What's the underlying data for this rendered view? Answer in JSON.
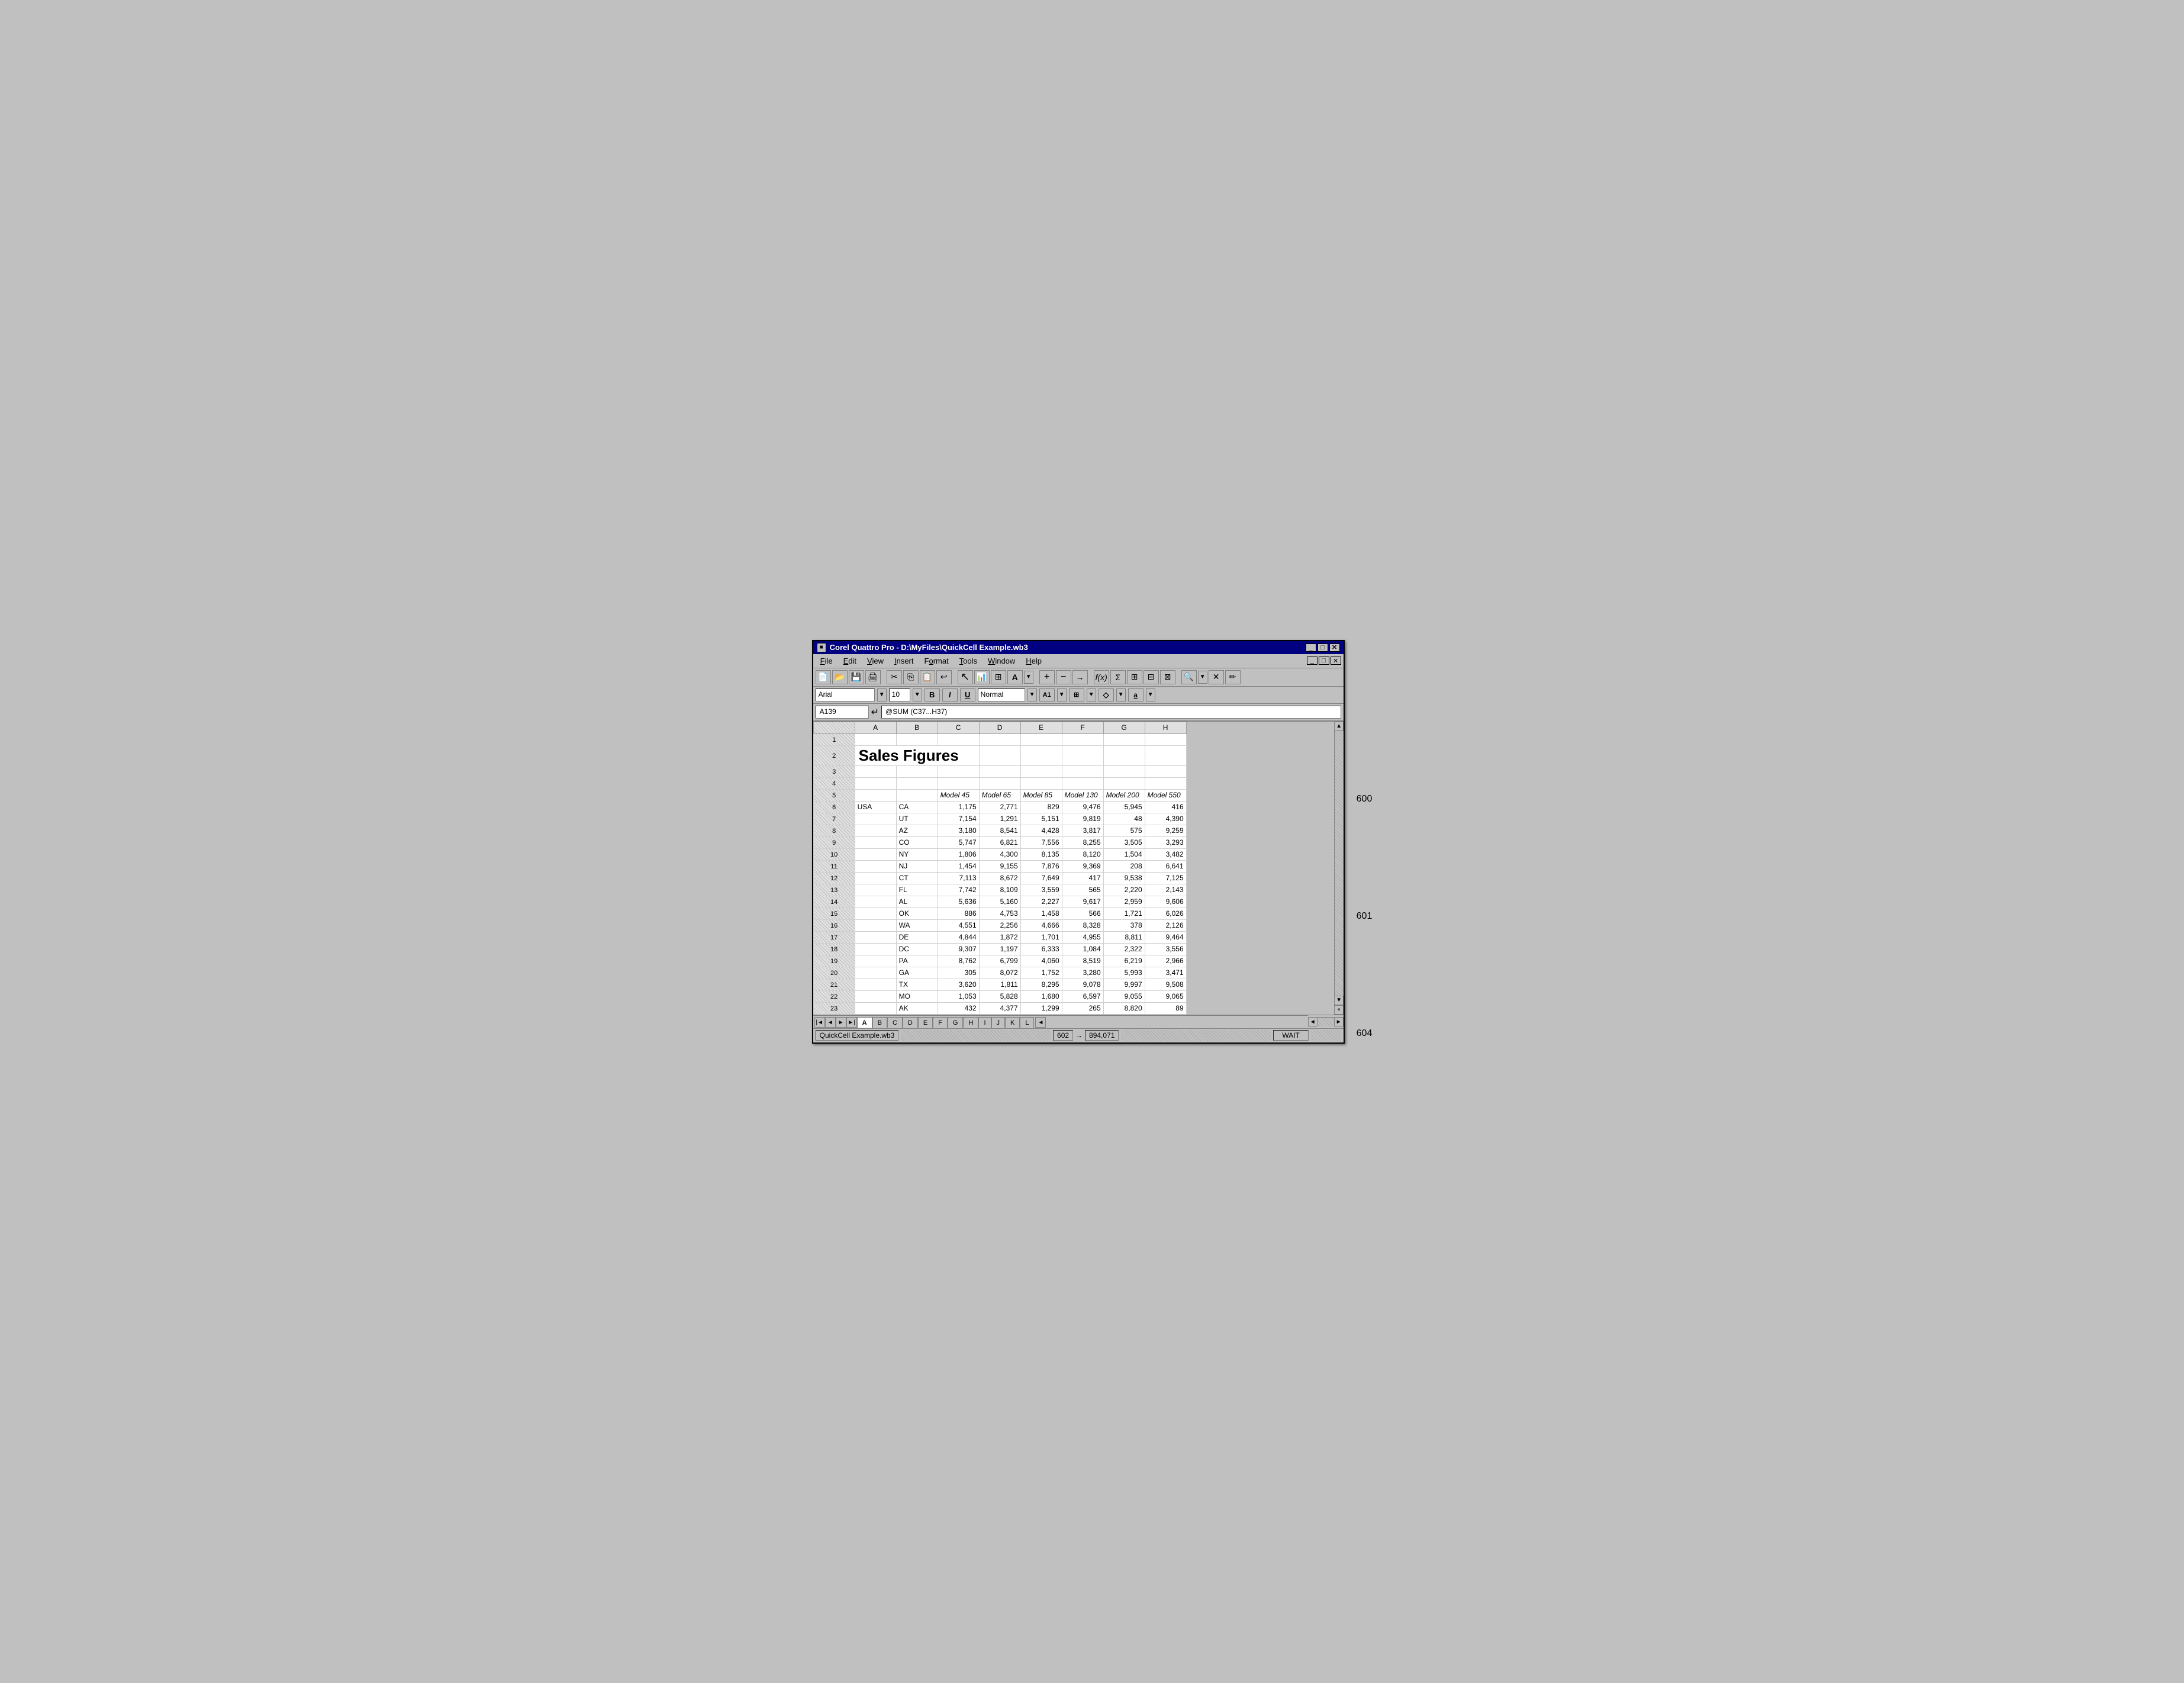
{
  "window": {
    "title": "Corel Quattro Pro - D:\\MyFiles\\QuickCell Example.wb3",
    "icon": "■"
  },
  "menu": {
    "items": [
      "File",
      "Edit",
      "View",
      "Insert",
      "Format",
      "Tools",
      "Window",
      "Help"
    ]
  },
  "formula_bar": {
    "cell_ref": "A139",
    "formula": "@SUM (C37...H37)"
  },
  "format_bar": {
    "font": "Arial",
    "size": "10",
    "style": "Normal",
    "bold": "B",
    "italic": "I",
    "underline": "U"
  },
  "columns": [
    "A",
    "B",
    "C",
    "D",
    "E",
    "F",
    "G",
    "H"
  ],
  "rows": [
    {
      "num": "1",
      "cells": [
        "",
        "",
        "",
        "",
        "",
        "",
        "",
        ""
      ]
    },
    {
      "num": "2",
      "cells": [
        "Sales Figures",
        "",
        "",
        "",
        "",
        "",
        "",
        ""
      ]
    },
    {
      "num": "3",
      "cells": [
        "",
        "",
        "",
        "",
        "",
        "",
        "",
        ""
      ]
    },
    {
      "num": "4",
      "cells": [
        "",
        "",
        "",
        "",
        "",
        "",
        "",
        ""
      ]
    },
    {
      "num": "5",
      "cells": [
        "",
        "",
        "Model 45",
        "Model 65",
        "Model 85",
        "Model 130",
        "Model 200",
        "Model 550"
      ]
    },
    {
      "num": "6",
      "cells": [
        "USA",
        "CA",
        "1,175",
        "2,771",
        "829",
        "9,476",
        "5,945",
        "416"
      ]
    },
    {
      "num": "7",
      "cells": [
        "",
        "UT",
        "7,154",
        "1,291",
        "5,151",
        "9,819",
        "48",
        "4,390"
      ]
    },
    {
      "num": "8",
      "cells": [
        "",
        "AZ",
        "3,180",
        "8,541",
        "4,428",
        "3,817",
        "575",
        "9,259"
      ]
    },
    {
      "num": "9",
      "cells": [
        "",
        "CO",
        "5,747",
        "6,821",
        "7,556",
        "8,255",
        "3,505",
        "3,293"
      ]
    },
    {
      "num": "10",
      "cells": [
        "",
        "NY",
        "1,806",
        "4,300",
        "8,135",
        "8,120",
        "1,504",
        "3,482"
      ]
    },
    {
      "num": "11",
      "cells": [
        "",
        "NJ",
        "1,454",
        "9,155",
        "7,876",
        "9,369",
        "208",
        "6,641"
      ]
    },
    {
      "num": "12",
      "cells": [
        "",
        "CT",
        "7,113",
        "8,672",
        "7,649",
        "417",
        "9,538",
        "7,125"
      ]
    },
    {
      "num": "13",
      "cells": [
        "",
        "FL",
        "7,742",
        "8,109",
        "3,559",
        "565",
        "2,220",
        "2,143"
      ]
    },
    {
      "num": "14",
      "cells": [
        "",
        "AL",
        "5,636",
        "5,160",
        "2,227",
        "9,617",
        "2,959",
        "9,606"
      ]
    },
    {
      "num": "15",
      "cells": [
        "",
        "OK",
        "886",
        "4,753",
        "1,458",
        "566",
        "1,721",
        "6,026"
      ]
    },
    {
      "num": "16",
      "cells": [
        "",
        "WA",
        "4,551",
        "2,256",
        "4,666",
        "8,328",
        "378",
        "2,126"
      ]
    },
    {
      "num": "17",
      "cells": [
        "",
        "DE",
        "4,844",
        "1,872",
        "1,701",
        "4,955",
        "8,811",
        "9,464"
      ]
    },
    {
      "num": "18",
      "cells": [
        "",
        "DC",
        "9,307",
        "1,197",
        "6,333",
        "1,084",
        "2,322",
        "3,556"
      ]
    },
    {
      "num": "19",
      "cells": [
        "",
        "PA",
        "8,762",
        "6,799",
        "4,060",
        "8,519",
        "6,219",
        "2,966"
      ]
    },
    {
      "num": "20",
      "cells": [
        "",
        "GA",
        "305",
        "8,072",
        "1,752",
        "3,280",
        "5,993",
        "3,471"
      ]
    },
    {
      "num": "21",
      "cells": [
        "",
        "TX",
        "3,620",
        "1,811",
        "8,295",
        "9,078",
        "9,997",
        "9,508"
      ]
    },
    {
      "num": "22",
      "cells": [
        "",
        "MO",
        "1,053",
        "5,828",
        "1,680",
        "6,597",
        "9,055",
        "9,065"
      ]
    },
    {
      "num": "23",
      "cells": [
        "",
        "AK",
        "432",
        "4,377",
        "1,299",
        "265",
        "8,820",
        "89"
      ]
    }
  ],
  "sheet_tabs": [
    "A",
    "B",
    "C",
    "D",
    "E",
    "F",
    "G",
    "H",
    "I",
    "J",
    "K",
    "L"
  ],
  "status": {
    "filename": "QuickCell Example.wb3",
    "page": "602",
    "total": "894,071",
    "mode": "WAIT"
  },
  "ref_labels": {
    "label600": "600",
    "label601": "601",
    "label604": "604"
  },
  "toolbar_icons": [
    "new-doc",
    "open-doc",
    "save",
    "print",
    "cut",
    "copy",
    "paste",
    "undo",
    "pointer",
    "chart",
    "copy2",
    "font-a",
    "font-a-dropdown",
    "plus",
    "minus",
    "arrow",
    "function",
    "sum",
    "grid1",
    "grid2",
    "grid3",
    "zoom",
    "zoom-dropdown",
    "pen",
    "eraser"
  ]
}
